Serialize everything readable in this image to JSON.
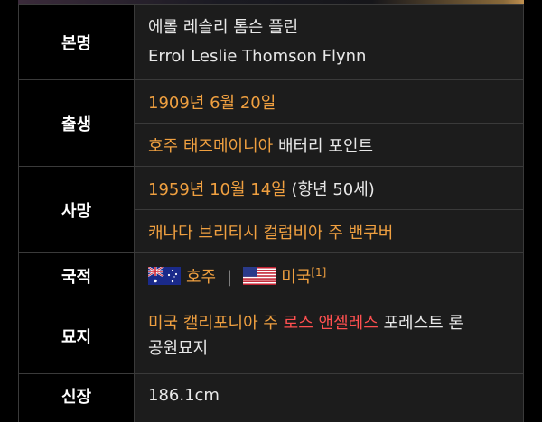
{
  "rows": {
    "name": {
      "label": "본명",
      "korean": "에롤 레슬리 톰슨 플린",
      "english": "Errol Leslie Thomson Flynn"
    },
    "birth": {
      "label": "출생",
      "date": "1909년 6월 20일",
      "place_link": "호주 태즈메이니아",
      "place_rest": "배터리 포인트"
    },
    "death": {
      "label": "사망",
      "date": "1959년 10월 14일",
      "age": "(향년 50세)",
      "place": "캐나다 브리티시 컬럼비아 주 밴쿠버"
    },
    "nationality": {
      "label": "국적",
      "country1": "호주",
      "country1_flag": "australia-flag-icon",
      "separator": "|",
      "country2": "미국",
      "country2_flag": "usa-flag-icon",
      "footnote": "[1]"
    },
    "grave": {
      "label": "묘지",
      "part1": "미국 캘리포니아 주",
      "part2": "로스 앤젤레스",
      "part3": "포레스트 론",
      "part4": "공원묘지"
    },
    "height": {
      "label": "신장",
      "value": "186.1cm"
    }
  },
  "colors": {
    "label_bg": "#000000",
    "value_bg": "#1c1c1c",
    "link_orange": "#f0a040",
    "link_red": "#ff5050",
    "border": "#3a3a3a"
  }
}
